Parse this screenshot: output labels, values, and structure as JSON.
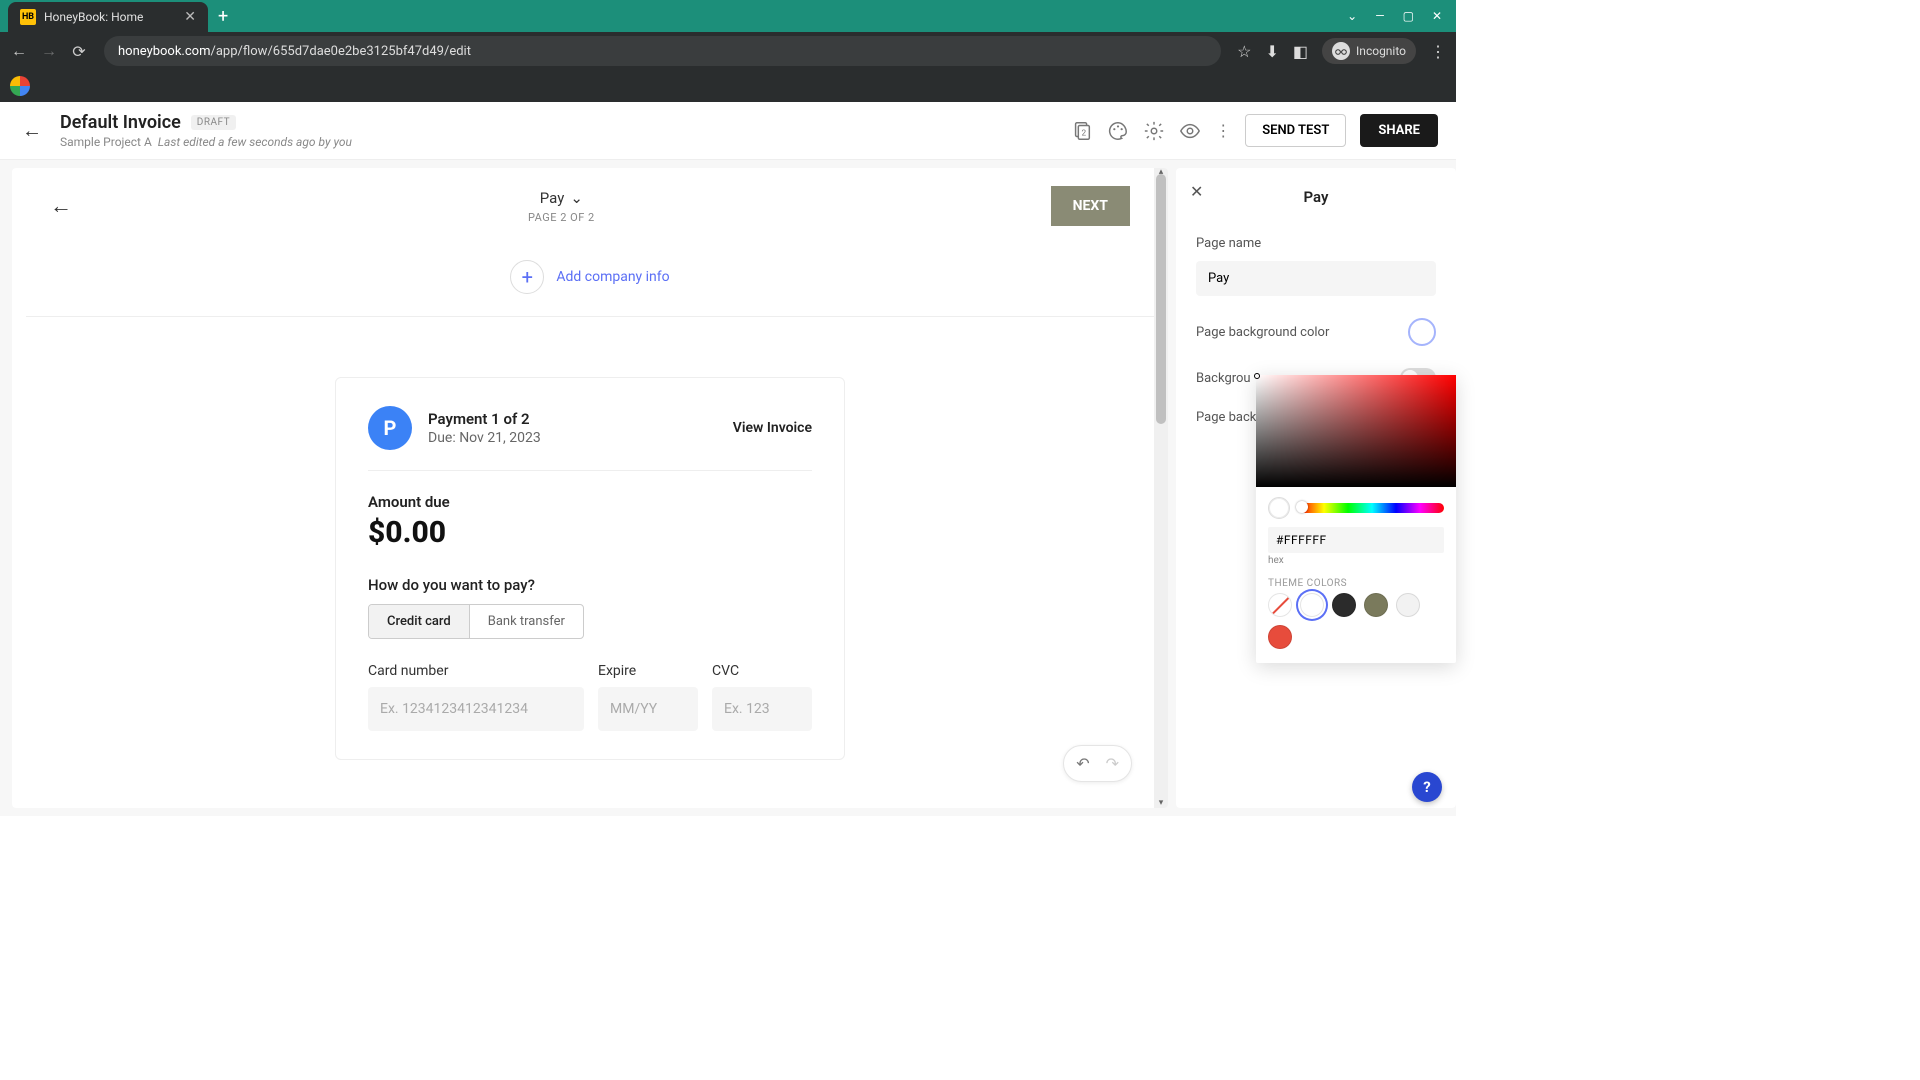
{
  "browser": {
    "tab_title": "HoneyBook: Home",
    "url_display": "honeybook.com/app/flow/655d7dae0e2be3125bf47d49/edit",
    "incognito_label": "Incognito"
  },
  "header": {
    "title": "Default Invoice",
    "badge": "DRAFT",
    "project": "Sample Project A",
    "last_edited": "Last edited a few seconds ago by you",
    "send_test": "SEND TEST",
    "share": "SHARE"
  },
  "canvas": {
    "step_label": "Pay",
    "page_counter": "PAGE 2 OF 2",
    "next": "NEXT",
    "add_company": "Add company info",
    "payment": {
      "avatar_initial": "P",
      "title": "Payment 1 of 2",
      "due": "Due: Nov 21, 2023",
      "view": "View Invoice",
      "amount_label": "Amount due",
      "amount_value": "$0.00",
      "how_label": "How do you want to pay?",
      "opt_credit": "Credit card",
      "opt_bank": "Bank transfer",
      "card_number_label": "Card number",
      "card_number_ph": "Ex. 1234123412341234",
      "expire_label": "Expire",
      "expire_ph": "MM/YY",
      "cvc_label": "CVC",
      "cvc_ph": "Ex. 123"
    }
  },
  "sidebar": {
    "title": "Pay",
    "page_name_label": "Page name",
    "page_name_value": "Pay",
    "bg_color_label": "Page background color",
    "bg_image_label": "Background image",
    "bg_image_label_trunc": "Backgrou",
    "page_bg_trunc": "Page back"
  },
  "color_picker": {
    "hex_value": "#FFFFFF",
    "hex_label": "hex",
    "theme_label": "THEME COLORS",
    "swatches": [
      {
        "name": "none",
        "color": "#ffffff"
      },
      {
        "name": "white",
        "color": "#ffffff"
      },
      {
        "name": "dark",
        "color": "#2b2b2b"
      },
      {
        "name": "olive",
        "color": "#7a7a5c"
      },
      {
        "name": "light",
        "color": "#f2f2f2"
      },
      {
        "name": "red",
        "color": "#e74c3c"
      }
    ]
  }
}
